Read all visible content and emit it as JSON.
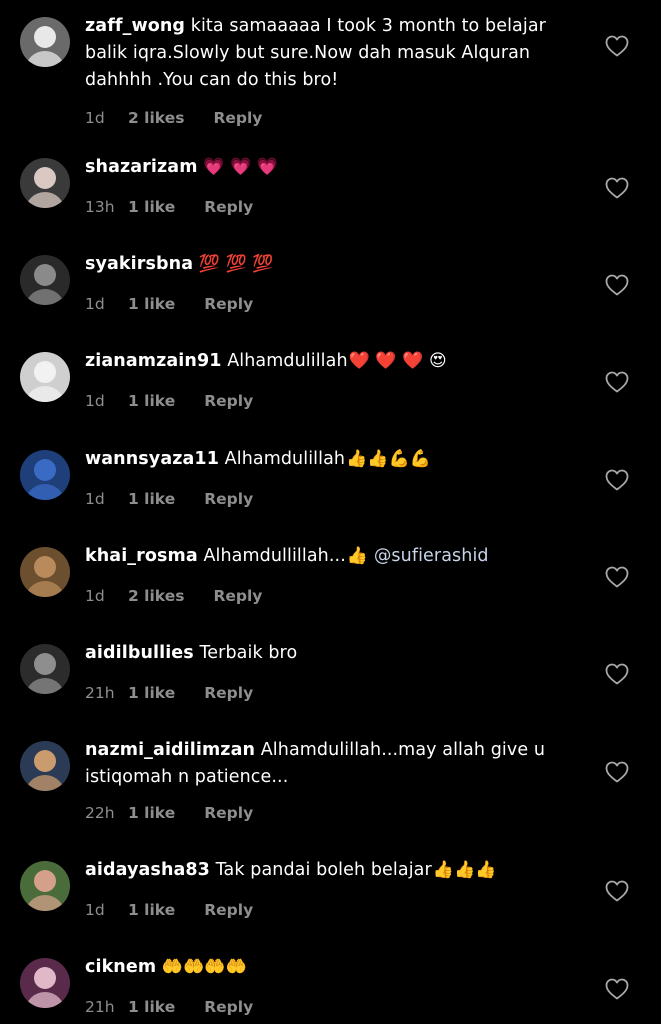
{
  "colors": {
    "background": "#000000",
    "text": "#ffffff",
    "meta": "#8e8e8e",
    "mention": "#c8d4e8"
  },
  "comments": [
    {
      "username": "zaff_wong",
      "text_lines": [
        "kita samaaaaa I took 3 month to belajar",
        "balik iqra.Slowly but sure.Now dah masuk Alquran",
        "dahhhh .You can do this bro!"
      ],
      "time": "1d",
      "likes": "2 likes",
      "reply": "Reply",
      "avatar_colors": [
        "#e8e8e8",
        "#6a6a6a"
      ]
    },
    {
      "username": "shazarizam",
      "emojis": "💗 💗 💗",
      "time": "13h",
      "likes": "1 like",
      "reply": "Reply",
      "avatar_colors": [
        "#d9c9c2",
        "#3a3a3a"
      ]
    },
    {
      "username": "syakirsbna",
      "emojis": "💯 💯 💯",
      "time": "1d",
      "likes": "1 like",
      "reply": "Reply",
      "avatar_colors": [
        "#8a8a8a",
        "#2a2a2a"
      ]
    },
    {
      "username": "zianamzain91",
      "text": "Alhamdulillah",
      "emojis": "❤️ ❤️ ❤️ 😍",
      "time": "1d",
      "likes": "1 like",
      "reply": "Reply",
      "avatar_colors": [
        "#f2f2f2",
        "#cfcfcf"
      ]
    },
    {
      "username": "wannsyaza11",
      "text": "Alhamdulillah",
      "emojis": "👍👍💪💪",
      "time": "1d",
      "likes": "1 like",
      "reply": "Reply",
      "avatar_colors": [
        "#3a6bc4",
        "#1f3f7a"
      ]
    },
    {
      "username": "khai_rosma",
      "text": "Alhamdullillah...",
      "emojis": "👍",
      "mention": "@sufierashid",
      "time": "1d",
      "likes": "2 likes",
      "reply": "Reply",
      "avatar_colors": [
        "#b88a5c",
        "#6b4f2e"
      ]
    },
    {
      "username": "aidilbullies",
      "text": "Terbaik bro",
      "time": "21h",
      "likes": "1 like",
      "reply": "Reply",
      "avatar_colors": [
        "#8e8e8e",
        "#2c2c2c"
      ]
    },
    {
      "username": "nazmi_aidilimzan",
      "text_lines": [
        "Alhamdulillah...may allah give u",
        "istiqomah n patience..."
      ],
      "time": "22h",
      "likes": "1 like",
      "reply": "Reply",
      "avatar_colors": [
        "#c99b6d",
        "#2b3a55"
      ]
    },
    {
      "username": "aidayasha83",
      "text": "Tak pandai boleh belajar",
      "emojis": "👍👍👍",
      "time": "1d",
      "likes": "1 like",
      "reply": "Reply",
      "avatar_colors": [
        "#d4a08a",
        "#4a6b3a"
      ]
    },
    {
      "username": "ciknem",
      "emojis": "🤲🤲🤲🤲",
      "time": "21h",
      "likes": "1 like",
      "reply": "Reply",
      "avatar_colors": [
        "#e0b8c8",
        "#5a2a4a"
      ]
    }
  ],
  "icons": {
    "like": "heart-outline-icon"
  }
}
